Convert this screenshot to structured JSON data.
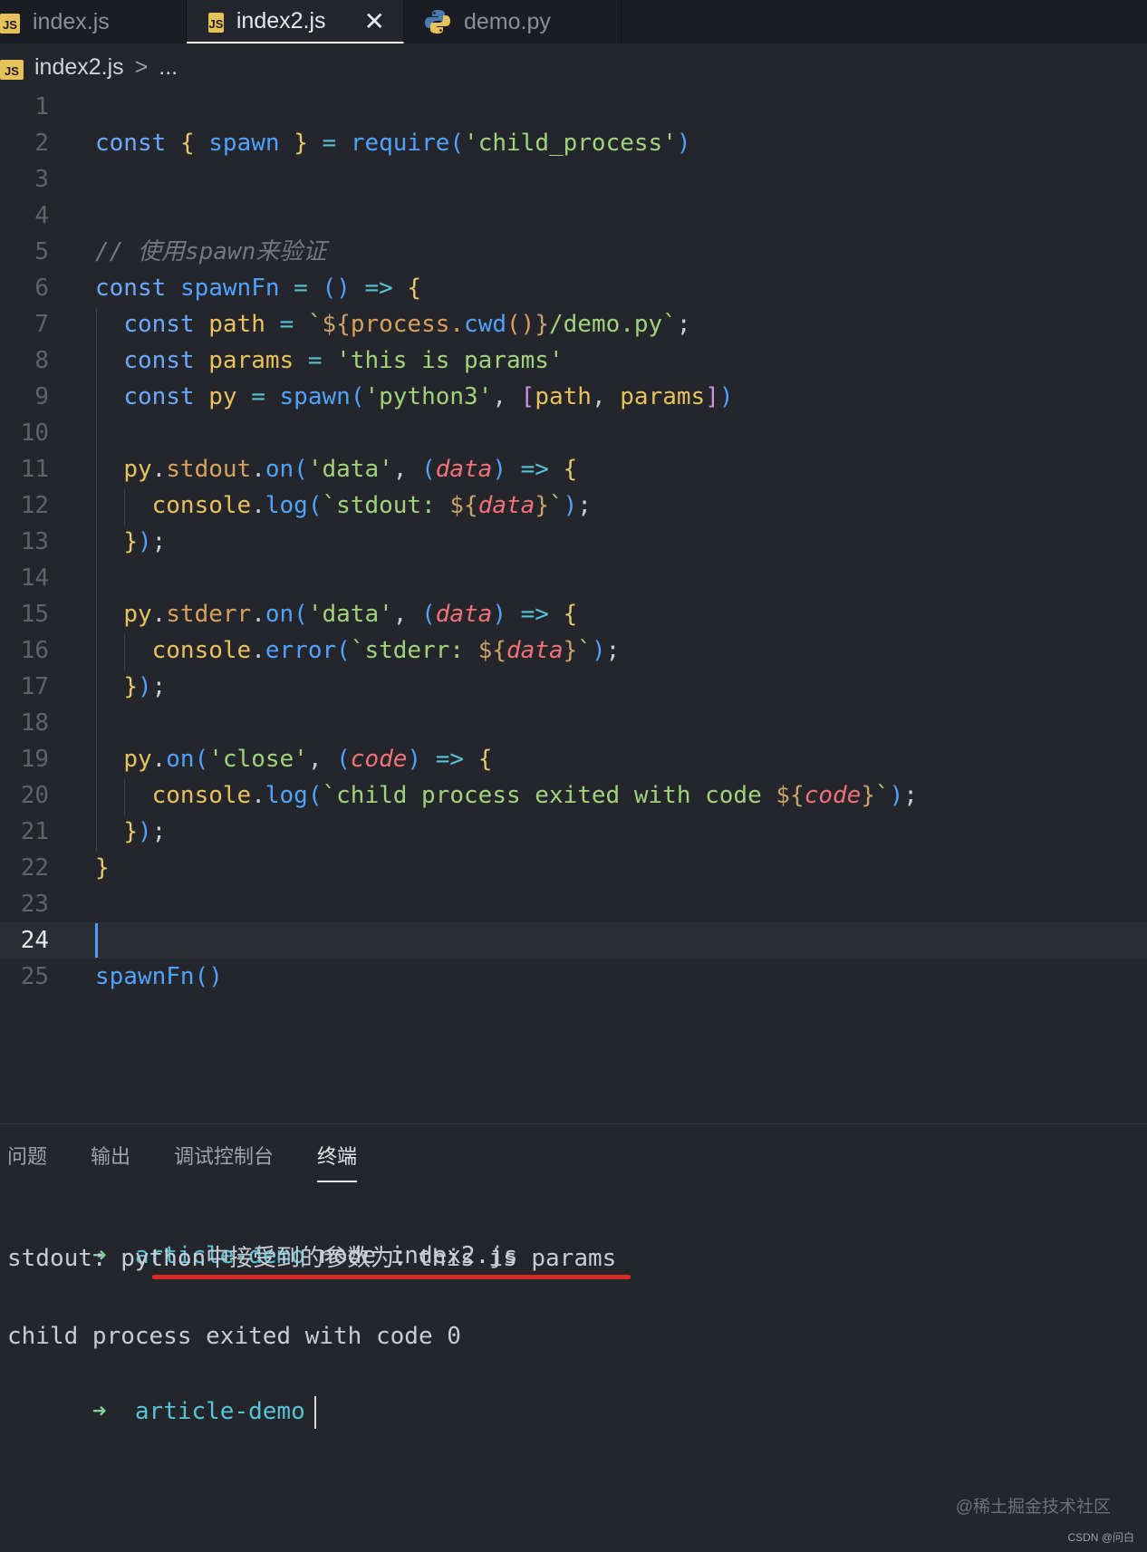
{
  "tabs": [
    {
      "label": "index.js",
      "icon": "js-file-icon",
      "icon_text": "JS"
    },
    {
      "label": "index2.js",
      "icon": "js-file-icon",
      "icon_text": "JS",
      "active": true,
      "close": "✕"
    },
    {
      "label": "demo.py",
      "icon": "python-file-icon"
    }
  ],
  "breadcrumb": {
    "icon_text": "JS",
    "file": "index2.js",
    "sep": ">",
    "more": "..."
  },
  "editor": {
    "line_numbers": [
      "1",
      "2",
      "3",
      "4",
      "5",
      "6",
      "7",
      "8",
      "9",
      "10",
      "11",
      "12",
      "13",
      "14",
      "15",
      "16",
      "17",
      "18",
      "19",
      "20",
      "21",
      "22",
      "23",
      "24",
      "25"
    ],
    "current_line": "24",
    "lines": [
      "",
      "const { spawn } = require('child_process')",
      "",
      "",
      "// 使用spawn来验证",
      "const spawnFn = () => {",
      "  const path = `${process.cwd()}/demo.py`;",
      "  const params = 'this is params'",
      "  const py = spawn('python3', [path, params])",
      "",
      "  py.stdout.on('data', (data) => {",
      "    console.log(`stdout: ${data}`);",
      "  });",
      "",
      "  py.stderr.on('data', (data) => {",
      "    console.error(`stderr: ${data}`);",
      "  });",
      "",
      "  py.on('close', (code) => {",
      "    console.log(`child process exited with code ${code}`);",
      "  });",
      "}",
      "",
      "",
      "spawnFn()"
    ]
  },
  "panel": {
    "tabs": [
      "问题",
      "输出",
      "调试控制台",
      "终端"
    ],
    "active_tab": "终端"
  },
  "terminal": {
    "prompt_arrow": "➜",
    "dir": "article-demo",
    "command": "node index2.js",
    "stdout_line": "stdout: python中接受到的参数为：this is params",
    "exit_line": "child process exited with code 0"
  },
  "colors": {
    "accent_underline": "#d22a22",
    "cursor": "#4f9cff"
  },
  "watermark": {
    "main": "@稀土掘金技术社区",
    "small": "CSDN @问白"
  }
}
